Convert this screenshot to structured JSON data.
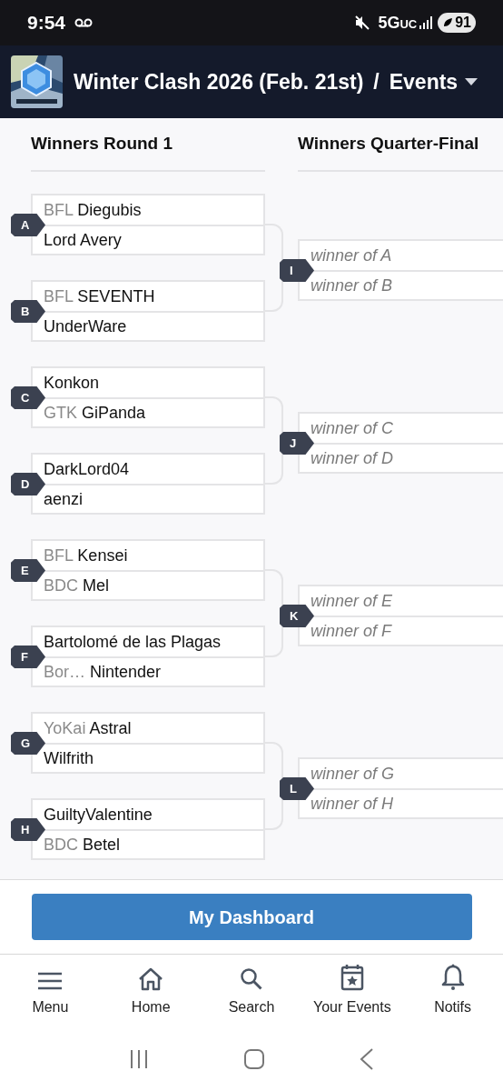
{
  "status_bar": {
    "time": "9:54",
    "network": "5G",
    "network_sub": "UC",
    "battery": "91"
  },
  "header": {
    "title": "Winter Clash 2026 (Feb. 21st)",
    "separator": "/",
    "section": "Events"
  },
  "rounds": [
    {
      "title": "Winners Round 1",
      "matches": [
        {
          "id": "A",
          "slots": [
            {
              "kind": "player",
              "tag": "BFL",
              "name": "Diegubis"
            },
            {
              "kind": "player",
              "name": "Lord Avery"
            }
          ]
        },
        {
          "id": "B",
          "slots": [
            {
              "kind": "player",
              "tag": "BFL",
              "name": "SEVENTH"
            },
            {
              "kind": "player",
              "name": "UnderWare"
            }
          ]
        },
        {
          "id": "C",
          "slots": [
            {
              "kind": "player",
              "name": "Konkon"
            },
            {
              "kind": "player",
              "tag": "GTK",
              "name": "GiPanda"
            }
          ]
        },
        {
          "id": "D",
          "slots": [
            {
              "kind": "player",
              "name": "DarkLord04"
            },
            {
              "kind": "player",
              "name": "aenzi"
            }
          ]
        },
        {
          "id": "E",
          "slots": [
            {
              "kind": "player",
              "tag": "BFL",
              "name": "Kensei"
            },
            {
              "kind": "player",
              "tag": "BDC",
              "name": "Mel"
            }
          ]
        },
        {
          "id": "F",
          "slots": [
            {
              "kind": "player",
              "name": "Bartolomé de las Plagas"
            },
            {
              "kind": "player",
              "tag": "Bor…",
              "name": "Nintender"
            }
          ]
        },
        {
          "id": "G",
          "slots": [
            {
              "kind": "player",
              "tag": "YoKai",
              "name": "Astral"
            },
            {
              "kind": "player",
              "name": "Wilfrith"
            }
          ]
        },
        {
          "id": "H",
          "slots": [
            {
              "kind": "player",
              "name": "GuiltyValentine"
            },
            {
              "kind": "player",
              "tag": "BDC",
              "name": "Betel"
            }
          ]
        }
      ]
    },
    {
      "title": "Winners Quarter-Final",
      "matches": [
        {
          "id": "I",
          "slots": [
            {
              "kind": "pending",
              "name": "winner of A"
            },
            {
              "kind": "pending",
              "name": "winner of B"
            }
          ]
        },
        {
          "id": "J",
          "slots": [
            {
              "kind": "pending",
              "name": "winner of C"
            },
            {
              "kind": "pending",
              "name": "winner of D"
            }
          ]
        },
        {
          "id": "K",
          "slots": [
            {
              "kind": "pending",
              "name": "winner of E"
            },
            {
              "kind": "pending",
              "name": "winner of F"
            }
          ]
        },
        {
          "id": "L",
          "slots": [
            {
              "kind": "pending",
              "name": "winner of G"
            },
            {
              "kind": "pending",
              "name": "winner of H"
            }
          ]
        }
      ]
    }
  ],
  "dashboard_button": "My Dashboard",
  "bottom_nav": [
    {
      "label": "Menu"
    },
    {
      "label": "Home"
    },
    {
      "label": "Search"
    },
    {
      "label": "Your Events"
    },
    {
      "label": "Notifs"
    }
  ]
}
